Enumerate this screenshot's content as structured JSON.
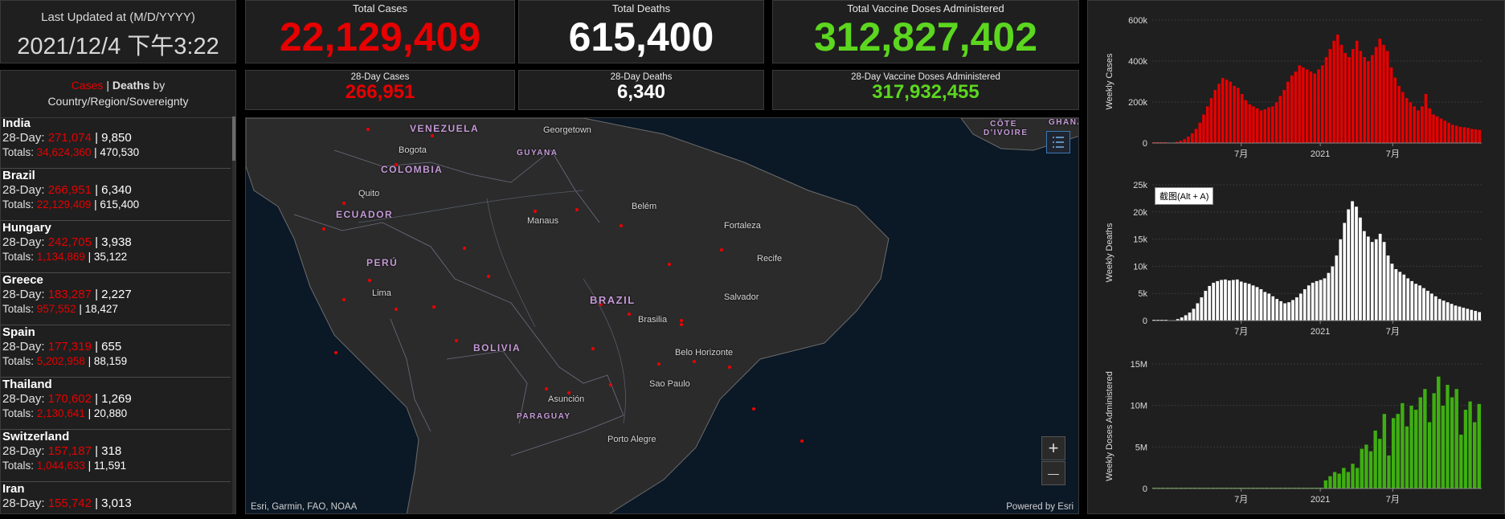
{
  "last_updated": {
    "label": "Last Updated at (M/D/YYYY)",
    "value": "2021/12/4 下午3:22"
  },
  "totals": {
    "cases": {
      "label": "Total Cases",
      "value": "22,129,409"
    },
    "deaths": {
      "label": "Total Deaths",
      "value": "615,400"
    },
    "vaccines": {
      "label": "Total Vaccine Doses Administered",
      "value": "312,827,402"
    }
  },
  "day28": {
    "cases": {
      "label": "28-Day Cases",
      "value": "266,951"
    },
    "deaths": {
      "label": "28-Day Deaths",
      "value": "6,340"
    },
    "vaccines": {
      "label": "28-Day Vaccine Doses Administered",
      "value": "317,932,455"
    }
  },
  "list": {
    "header": {
      "cases": "Cases",
      "sep": " | ",
      "deaths": "Deaths",
      "by": " by",
      "line2": "Country/Region/Sovereignty"
    },
    "prefix_28": "28-Day: ",
    "prefix_totals": "Totals: ",
    "items": [
      {
        "name": "India",
        "d28_cases": "271,074",
        "d28_deaths": "9,850",
        "tot_cases": "34,624,360",
        "tot_deaths": "470,530"
      },
      {
        "name": "Brazil",
        "d28_cases": "266,951",
        "d28_deaths": "6,340",
        "tot_cases": "22,129,409",
        "tot_deaths": "615,400"
      },
      {
        "name": "Hungary",
        "d28_cases": "242,705",
        "d28_deaths": "3,938",
        "tot_cases": "1,134,869",
        "tot_deaths": "35,122"
      },
      {
        "name": "Greece",
        "d28_cases": "183,287",
        "d28_deaths": "2,227",
        "tot_cases": "957,552",
        "tot_deaths": "18,427"
      },
      {
        "name": "Spain",
        "d28_cases": "177,319",
        "d28_deaths": "655",
        "tot_cases": "5,202,958",
        "tot_deaths": "88,159"
      },
      {
        "name": "Thailand",
        "d28_cases": "170,602",
        "d28_deaths": "1,269",
        "tot_cases": "2,130,641",
        "tot_deaths": "20,880"
      },
      {
        "name": "Switzerland",
        "d28_cases": "157,187",
        "d28_deaths": "318",
        "tot_cases": "1,044,633",
        "tot_deaths": "11,591"
      },
      {
        "name": "Iran",
        "d28_cases": "155,742",
        "d28_deaths": "3,013",
        "tot_cases": "",
        "tot_deaths": ""
      }
    ]
  },
  "map": {
    "countries": [
      "VENEZUELA",
      "COLOMBIA",
      "ECUADOR",
      "PERÚ",
      "BRAZIL",
      "BOLIVIA",
      "PARAGUAY",
      "GUYANA",
      "CÔTE D'IVOIRE",
      "GHANA"
    ],
    "cities": [
      "Georgetown",
      "Bogota",
      "Quito",
      "Manaus",
      "Belém",
      "Fortaleza",
      "Recife",
      "Salvador",
      "Lima",
      "Brasilia",
      "Belo Horizonte",
      "Sao Paulo",
      "Asunción",
      "Porto Alegre"
    ],
    "attribution_left": "Esri, Garmin, FAO, NOAA",
    "attribution_right": "Powered by Esri",
    "zoom_in": "+",
    "zoom_out": "—",
    "legend_icon": "legend-list-icon"
  },
  "tooltip": "截图(Alt + A)",
  "chart_data": [
    {
      "type": "bar",
      "color": "#e60000",
      "ylabel": "Weekly Cases",
      "yticks": [
        "0",
        "200k",
        "400k",
        "600k"
      ],
      "ylim": [
        0,
        600000
      ],
      "xticks": [
        "7月",
        "2021",
        "7月"
      ],
      "values": [
        0,
        0,
        0,
        0,
        1000,
        3000,
        7000,
        12000,
        20000,
        32000,
        48000,
        70000,
        100000,
        140000,
        180000,
        220000,
        260000,
        290000,
        318000,
        310000,
        300000,
        280000,
        270000,
        240000,
        210000,
        190000,
        180000,
        170000,
        160000,
        165000,
        175000,
        180000,
        200000,
        230000,
        260000,
        300000,
        330000,
        350000,
        380000,
        370000,
        360000,
        350000,
        340000,
        360000,
        380000,
        420000,
        460000,
        500000,
        530000,
        480000,
        440000,
        420000,
        460000,
        500000,
        450000,
        420000,
        400000,
        430000,
        470000,
        510000,
        480000,
        450000,
        370000,
        320000,
        280000,
        250000,
        220000,
        200000,
        180000,
        160000,
        180000,
        240000,
        170000,
        140000,
        130000,
        120000,
        110000,
        100000,
        90000,
        85000,
        80000,
        78000,
        75000,
        70000,
        68000,
        65000
      ]
    },
    {
      "type": "bar",
      "color": "#ffffff",
      "ylabel": "Weekly Deaths",
      "yticks": [
        "0",
        "5k",
        "10k",
        "15k",
        "20k",
        "25k"
      ],
      "ylim": [
        0,
        25000
      ],
      "xticks": [
        "7月",
        "2021",
        "7月"
      ],
      "values": [
        0,
        0,
        0,
        0,
        50,
        100,
        300,
        600,
        1000,
        1500,
        2200,
        3200,
        4300,
        5500,
        6400,
        7000,
        7300,
        7500,
        7600,
        7400,
        7500,
        7600,
        7200,
        7000,
        6800,
        6500,
        6200,
        5800,
        5300,
        5000,
        4500,
        4000,
        3600,
        3200,
        3400,
        3800,
        4300,
        5000,
        5800,
        6500,
        7000,
        7300,
        7500,
        7800,
        8800,
        10000,
        12000,
        15000,
        18000,
        20500,
        22000,
        21000,
        19000,
        16500,
        15500,
        14500,
        15000,
        16000,
        14500,
        12000,
        10500,
        9500,
        9000,
        8500,
        7800,
        7300,
        6800,
        6500,
        6000,
        5500,
        5000,
        4500,
        4000,
        3700,
        3400,
        3100,
        2800,
        2600,
        2400,
        2200,
        2000,
        1800,
        1600
      ]
    },
    {
      "type": "bar",
      "color": "#3fae12",
      "ylabel": "Weekly Doses Administered",
      "yticks": [
        "0",
        "5M",
        "10M",
        "15M"
      ],
      "ylim": [
        0,
        15000000
      ],
      "xticks": [
        "7月",
        "2021",
        "7月"
      ],
      "values": [
        0,
        0,
        0,
        0,
        0,
        0,
        0,
        0,
        0,
        0,
        0,
        0,
        0,
        0,
        0,
        0,
        0,
        0,
        0,
        0,
        0,
        0,
        0,
        0,
        0,
        0,
        0,
        0,
        0,
        0,
        0,
        0,
        0,
        0,
        0,
        0,
        0,
        0,
        1000000,
        1500000,
        2000000,
        1800000,
        2500000,
        2000000,
        3000000,
        2500000,
        4800000,
        5300000,
        4500000,
        7000000,
        6000000,
        9000000,
        4000000,
        8500000,
        9000000,
        10300000,
        7500000,
        10000000,
        9500000,
        11000000,
        12000000,
        8000000,
        11500000,
        13500000,
        10000000,
        12500000,
        11000000,
        12000000,
        6500000,
        9500000,
        10500000,
        8000000,
        10200000
      ]
    }
  ]
}
